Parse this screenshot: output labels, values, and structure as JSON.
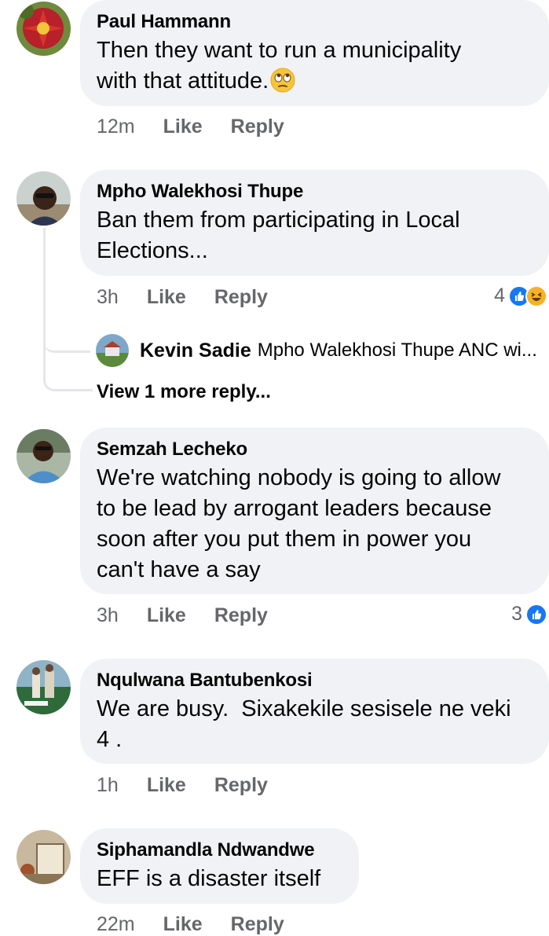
{
  "comments": [
    {
      "author": "Paul Hammann",
      "text_line1": "Then they want to run a municipality",
      "text_line2": "with that attitude.",
      "emoji": "eye-roll-emoji",
      "time": "12m",
      "like_label": "Like",
      "reply_label": "Reply"
    },
    {
      "author": "Mpho Walekhosi Thupe",
      "text_line1": "Ban them from participating in Local",
      "text_line2": "Elections...",
      "time": "3h",
      "like_label": "Like",
      "reply_label": "Reply",
      "reaction_count": "4",
      "reactions": [
        "like-icon",
        "haha-icon"
      ],
      "reply_preview": {
        "author": "Kevin Sadie",
        "snippet": "Mpho Walekhosi Thupe ANC wi..."
      },
      "more_replies_label": "View 1 more reply..."
    },
    {
      "author": "Semzah Lecheko",
      "text_line1": "We're watching nobody is going to allow",
      "text_line2": "to be lead by arrogant leaders because",
      "text_line3": "soon after you put them in power you",
      "text_line4": "can't have a say",
      "time": "3h",
      "like_label": "Like",
      "reply_label": "Reply",
      "reaction_count": "3",
      "reactions": [
        "like-icon"
      ]
    },
    {
      "author": "Nqulwana Bantubenkosi",
      "text_line1": "We are busy.  Sixakekile sesisele ne veki",
      "text_line2": "4 .",
      "time": "1h",
      "like_label": "Like",
      "reply_label": "Reply"
    },
    {
      "author": "Siphamandla Ndwandwe",
      "text_line1": "EFF is a disaster itself",
      "time": "22m",
      "like_label": "Like",
      "reply_label": "Reply"
    }
  ],
  "colors": {
    "bubble": "#f0f2f5",
    "meta": "#65676b",
    "like_blue": "#1877f2",
    "haha_yellow": "#f7b125"
  }
}
